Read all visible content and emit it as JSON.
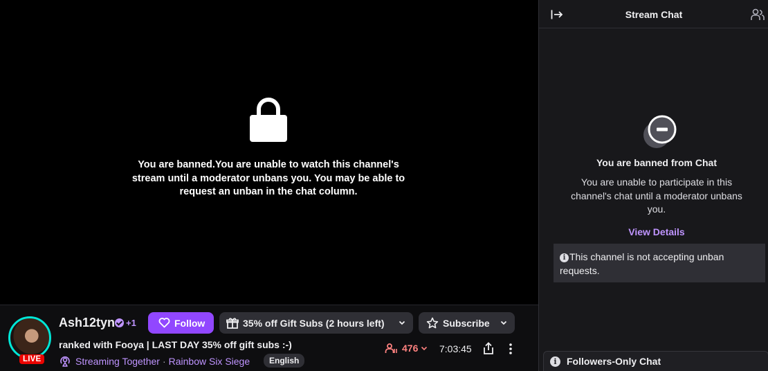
{
  "player": {
    "ban_message": "You are banned.You are unable to watch this channel's stream until a moderator unbans you. You may be able to request an unban in the chat column."
  },
  "channel": {
    "live_badge": "LIVE",
    "name": "Ash12tyn",
    "collab_count": "+1",
    "follow_label": "Follow",
    "gift_label": "35% off Gift Subs (2 hours left)",
    "subscribe_label": "Subscribe",
    "stream_title": "ranked with Fooya | LAST DAY 35% off gift subs :-)",
    "streaming_together": "Streaming Together",
    "separator": "·",
    "category": "Rainbow Six Siege",
    "tag": "English",
    "viewers": "476",
    "uptime": "7:03:45"
  },
  "chat": {
    "title": "Stream Chat",
    "ban_title": "You are banned from Chat",
    "ban_message": "You are unable to participate in this channel's chat until a moderator unbans you.",
    "view_details": "View Details",
    "notice": "This channel is not accepting unban requests.",
    "followers_only": "Followers-Only Chat"
  },
  "colors": {
    "accent": "#9147ff",
    "accent_text": "#bf94ff",
    "live": "#eb0400",
    "viewers": "#ff8280"
  }
}
